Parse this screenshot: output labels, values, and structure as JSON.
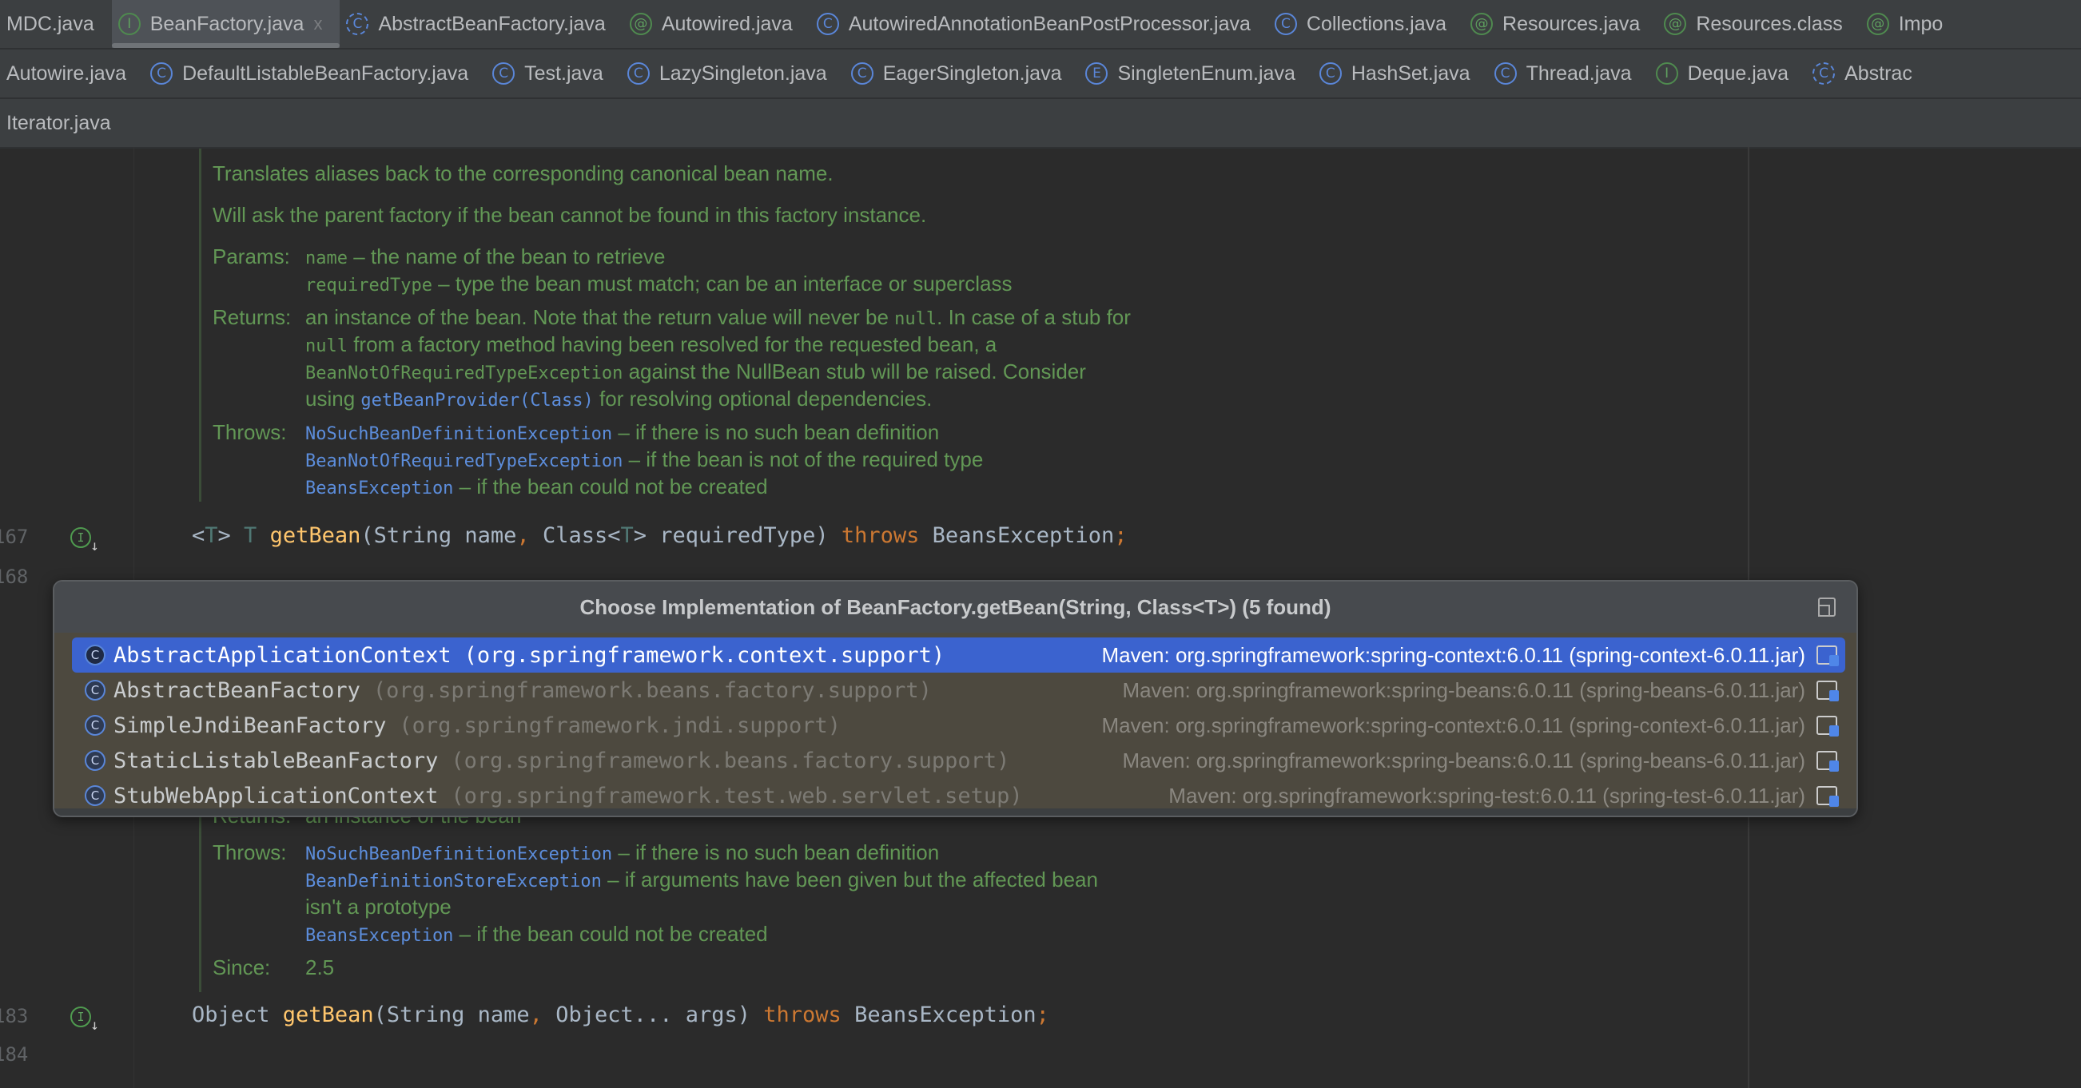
{
  "tabs": {
    "row1": [
      {
        "label": "MDC.java",
        "icon": "none"
      },
      {
        "label": "BeanFactory.java",
        "icon": "interface",
        "active": true,
        "close": "x"
      },
      {
        "label": "AbstractBeanFactory.java",
        "icon": "abstract-class"
      },
      {
        "label": "Autowired.java",
        "icon": "annotation"
      },
      {
        "label": "AutowiredAnnotationBeanPostProcessor.java",
        "icon": "class"
      },
      {
        "label": "Collections.java",
        "icon": "class"
      },
      {
        "label": "Resources.java",
        "icon": "annotation"
      },
      {
        "label": "Resources.class",
        "icon": "annotation"
      },
      {
        "label": "Impo",
        "icon": "annotation"
      }
    ],
    "row2": [
      {
        "label": "Autowire.java",
        "icon": "none"
      },
      {
        "label": "DefaultListableBeanFactory.java",
        "icon": "class"
      },
      {
        "label": "Test.java",
        "icon": "class"
      },
      {
        "label": "LazySingleton.java",
        "icon": "class"
      },
      {
        "label": "EagerSingleton.java",
        "icon": "class"
      },
      {
        "label": "SingletenEnum.java",
        "icon": "enum"
      },
      {
        "label": "HashSet.java",
        "icon": "class"
      },
      {
        "label": "Thread.java",
        "icon": "class"
      },
      {
        "label": "Deque.java",
        "icon": "interface"
      },
      {
        "label": "Abstrac",
        "icon": "abstract-class"
      }
    ],
    "row3": [
      {
        "label": "Iterator.java",
        "icon": "none"
      }
    ]
  },
  "doc1": [
    [
      {
        "t": "Translates aliases back to the corresponding canonical bean name."
      }
    ],
    [
      {
        "t": "Will ask the parent factory if the bean cannot be found in this factory instance."
      }
    ],
    [
      {
        "lbl": "Params:"
      },
      {
        "t": "name",
        "c": 1
      },
      {
        "t": " – the name of the bean to retrieve"
      }
    ],
    [
      {
        "lbl": ""
      },
      {
        "t": "requiredType",
        "c": 1
      },
      {
        "t": " – type the bean must match; can be an interface or superclass"
      }
    ],
    [
      {
        "lbl": "Returns:"
      },
      {
        "t": "an instance of the bean. Note that the return value will never be "
      },
      {
        "t": "null",
        "c": 1
      },
      {
        "t": ". In case of a stub for"
      }
    ],
    [
      {
        "lbl": ""
      },
      {
        "t": "null",
        "c": 1
      },
      {
        "t": " from a factory method having been resolved for the requested bean, a"
      }
    ],
    [
      {
        "lbl": ""
      },
      {
        "t": "BeanNotOfRequiredTypeException",
        "c": 1
      },
      {
        "t": " against the NullBean stub will be raised. Consider"
      }
    ],
    [
      {
        "lbl": ""
      },
      {
        "t": "using "
      },
      {
        "t": "getBeanProvider(Class)",
        "c": 1,
        "l": 1
      },
      {
        "t": " for resolving optional dependencies."
      }
    ],
    [
      {
        "lbl": "Throws:"
      },
      {
        "t": "NoSuchBeanDefinitionException",
        "c": 1,
        "l": 1
      },
      {
        "t": " – if there is no such bean definition"
      }
    ],
    [
      {
        "lbl": ""
      },
      {
        "t": "BeanNotOfRequiredTypeException",
        "c": 1,
        "l": 1
      },
      {
        "t": " – if the bean is not of the required type"
      }
    ],
    [
      {
        "lbl": ""
      },
      {
        "t": "BeansException",
        "c": 1,
        "l": 1
      },
      {
        "t": " – if the bean could not be created"
      }
    ]
  ],
  "doc2": [
    [
      {
        "lbl": "Returns:"
      },
      {
        "t": "an instance of the bean"
      }
    ],
    [
      {
        "lbl": "Throws:"
      },
      {
        "t": "NoSuchBeanDefinitionException",
        "c": 1,
        "l": 1
      },
      {
        "t": " – if there is no such bean definition"
      }
    ],
    [
      {
        "lbl": ""
      },
      {
        "t": "BeanDefinitionStoreException",
        "c": 1,
        "l": 1
      },
      {
        "t": " – if arguments have been given but the affected bean"
      }
    ],
    [
      {
        "lbl": ""
      },
      {
        "t": "isn't a prototype"
      }
    ],
    [
      {
        "lbl": ""
      },
      {
        "t": "BeansException",
        "c": 1,
        "l": 1
      },
      {
        "t": " – if the bean could not be created"
      }
    ],
    [
      {
        "lbl": "Since:"
      },
      {
        "t": "2.5"
      }
    ]
  ],
  "code": {
    "line167": {
      "num": "167",
      "tokens": [
        {
          "t": "<",
          "k": "p"
        },
        {
          "t": "T",
          "k": "tp"
        },
        {
          "t": "> ",
          "k": "p"
        },
        {
          "t": "T",
          "k": "tp"
        },
        {
          "t": " ",
          "k": "p"
        },
        {
          "t": "getBean",
          "k": "fn"
        },
        {
          "t": "(String name",
          "k": "p"
        },
        {
          "t": ",",
          "k": "kw"
        },
        {
          "t": " Class<",
          "k": "p"
        },
        {
          "t": "T",
          "k": "tp"
        },
        {
          "t": "> requiredType) ",
          "k": "p"
        },
        {
          "t": "throws",
          "k": "kw"
        },
        {
          "t": " BeansException",
          "k": "p"
        },
        {
          "t": ";",
          "k": "kw"
        }
      ]
    },
    "line168": {
      "num": "168"
    },
    "line183": {
      "num": "183",
      "tokens": [
        {
          "t": "Object ",
          "k": "p"
        },
        {
          "t": "getBean",
          "k": "fn"
        },
        {
          "t": "(String name",
          "k": "p"
        },
        {
          "t": ",",
          "k": "kw"
        },
        {
          "t": " Object... args) ",
          "k": "p"
        },
        {
          "t": "throws",
          "k": "kw"
        },
        {
          "t": " BeansException",
          "k": "p"
        },
        {
          "t": ";",
          "k": "kw"
        }
      ]
    },
    "line184": {
      "num": "184"
    },
    "gutter_icon": "I"
  },
  "popup": {
    "title": "Choose Implementation of BeanFactory.getBean(String, Class<T>) (5 found)",
    "items": [
      {
        "name": "AbstractApplicationContext",
        "pkg": "(org.springframework.context.support)",
        "source": "Maven: org.springframework:spring-context:6.0.11 (spring-context-6.0.11.jar)",
        "selected": true,
        "icon": "abstract-class"
      },
      {
        "name": "AbstractBeanFactory",
        "pkg": "(org.springframework.beans.factory.support)",
        "source": "Maven: org.springframework:spring-beans:6.0.11 (spring-beans-6.0.11.jar)",
        "icon": "abstract-class"
      },
      {
        "name": "SimpleJndiBeanFactory",
        "pkg": "(org.springframework.jndi.support)",
        "source": "Maven: org.springframework:spring-context:6.0.11 (spring-context-6.0.11.jar)",
        "icon": "class"
      },
      {
        "name": "StaticListableBeanFactory",
        "pkg": "(org.springframework.beans.factory.support)",
        "source": "Maven: org.springframework:spring-beans:6.0.11 (spring-beans-6.0.11.jar)",
        "icon": "class"
      },
      {
        "name": "StubWebApplicationContext",
        "pkg": "(org.springframework.test.web.servlet.setup)",
        "source": "Maven: org.springframework:spring-test:6.0.11 (spring-test-6.0.11.jar)",
        "icon": "class"
      }
    ]
  },
  "colors": {
    "accent": "#3b63cf",
    "doc": "#629755",
    "link": "#5c8ddb",
    "keyword": "#cc7832",
    "method": "#ffc66d"
  }
}
